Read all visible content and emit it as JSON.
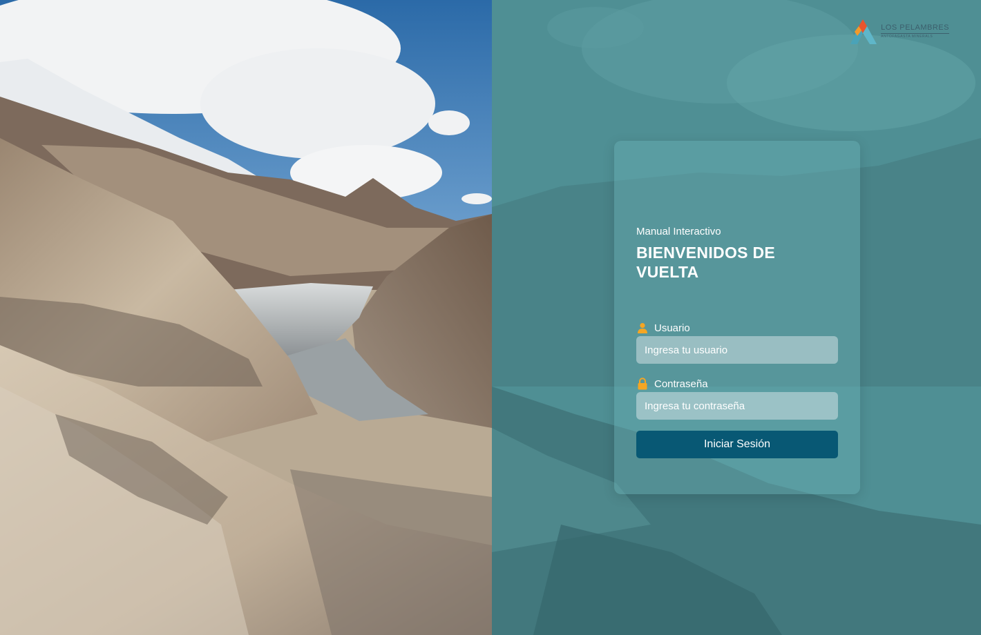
{
  "brand": {
    "name": "LOS PELAMBRES",
    "subtitle": "ANTOFAGASTA MINERALS",
    "logo_icon": "los-pelambres-logo"
  },
  "login": {
    "subtitle": "Manual Interactivo",
    "title": "BIENVENIDOS DE VUELTA",
    "username": {
      "label": "Usuario",
      "placeholder": "Ingresa tu usuario",
      "value": "",
      "icon": "user-icon"
    },
    "password": {
      "label": "Contraseña",
      "placeholder": "Ingresa tu contraseña",
      "value": "",
      "icon": "lock-icon"
    },
    "submit_label": "Iniciar Sesión"
  },
  "colors": {
    "panel": "#4f8e93",
    "card": "#6cb0b4",
    "button": "#085874",
    "icon_accent": "#f5a623"
  }
}
